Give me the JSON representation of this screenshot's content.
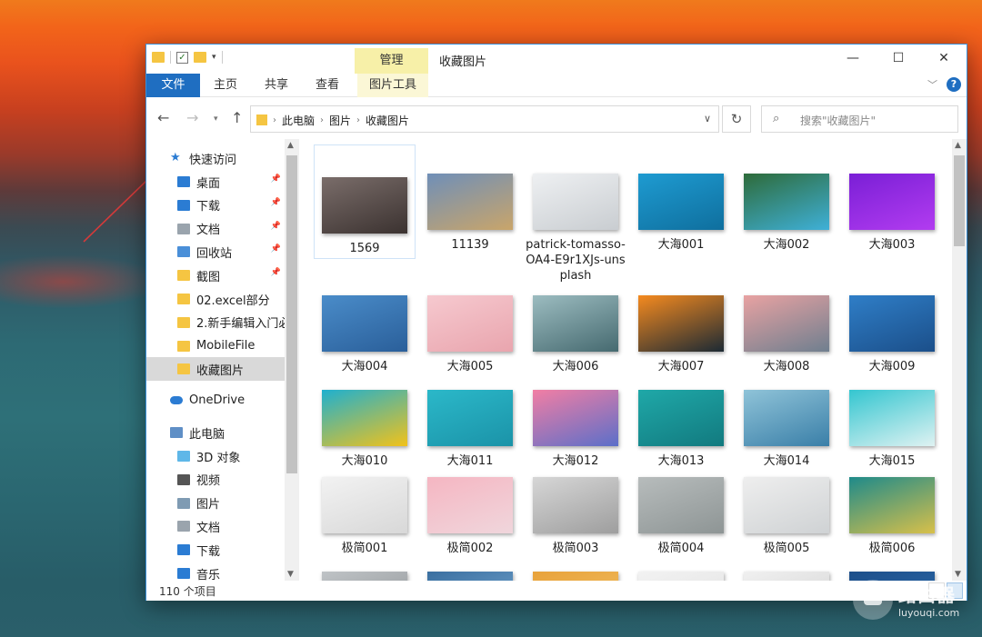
{
  "window": {
    "title": "收藏图片",
    "contextual_tab": "管理",
    "controls": {
      "minimize": "—",
      "maximize": "☐",
      "close": "✕"
    }
  },
  "ribbon": {
    "tabs": [
      "文件",
      "主页",
      "共享",
      "查看",
      "图片工具"
    ],
    "help": "?"
  },
  "address": {
    "crumbs": [
      "此电脑",
      "图片",
      "收藏图片"
    ],
    "search_placeholder": "搜索\"收藏图片\""
  },
  "sidebar": {
    "quick_access": "快速访问",
    "items": [
      {
        "label": "桌面",
        "icon": "desktop-icon",
        "color": "#2b7cd3",
        "pinned": true
      },
      {
        "label": "下载",
        "icon": "download-icon",
        "color": "#2b7cd3",
        "pinned": true
      },
      {
        "label": "文档",
        "icon": "document-icon",
        "color": "#9aa4ad",
        "pinned": true
      },
      {
        "label": "回收站",
        "icon": "recycle-bin-icon",
        "color": "#4a8fd8",
        "pinned": true
      },
      {
        "label": "截图",
        "icon": "folder-icon",
        "color": "#f5c542",
        "pinned": true
      },
      {
        "label": "02.excel部分",
        "icon": "folder-icon",
        "color": "#f5c542",
        "pinned": false
      },
      {
        "label": "2.新手编辑入门必",
        "icon": "folder-icon",
        "color": "#f5c542",
        "pinned": false
      },
      {
        "label": "MobileFile",
        "icon": "folder-icon",
        "color": "#f5c542",
        "pinned": false
      },
      {
        "label": "收藏图片",
        "icon": "folder-icon",
        "color": "#f5c542",
        "pinned": false,
        "selected": true
      }
    ],
    "onedrive": "OneDrive",
    "this_pc": "此电脑",
    "pc_items": [
      {
        "label": "3D 对象",
        "icon": "3d-objects-icon",
        "color": "#5fb7e8"
      },
      {
        "label": "视频",
        "icon": "video-icon",
        "color": "#555"
      },
      {
        "label": "图片",
        "icon": "picture-icon",
        "color": "#7f9bb3"
      },
      {
        "label": "文档",
        "icon": "document-icon",
        "color": "#9aa4ad"
      },
      {
        "label": "下载",
        "icon": "download-icon",
        "color": "#2b7cd3"
      },
      {
        "label": "音乐",
        "icon": "music-icon",
        "color": "#2b7cd3"
      }
    ]
  },
  "files": [
    {
      "name": "1569",
      "c1": "#7a6d6a",
      "c2": "#3b3230"
    },
    {
      "name": "11139",
      "c1": "#6f8fb8",
      "c2": "#c9a56a"
    },
    {
      "name": "patrick-tomasso-OA4-E9r1XJs-unsplash",
      "c1": "#eef0f2",
      "c2": "#c9cdd1"
    },
    {
      "name": "大海001",
      "c1": "#1e9bd1",
      "c2": "#0f6f9e"
    },
    {
      "name": "大海002",
      "c1": "#2e6b3a",
      "c2": "#3fb0d8"
    },
    {
      "name": "大海003",
      "c1": "#7a1fd6",
      "c2": "#b23cf0"
    },
    {
      "name": "大海004",
      "c1": "#4a8cc9",
      "c2": "#2a5f9a"
    },
    {
      "name": "大海005",
      "c1": "#f6c9cf",
      "c2": "#e9a5ae"
    },
    {
      "name": "大海006",
      "c1": "#9cbcc0",
      "c2": "#466a70"
    },
    {
      "name": "大海007",
      "c1": "#f58a1f",
      "c2": "#1c2a34"
    },
    {
      "name": "大海008",
      "c1": "#e8a2a2",
      "c2": "#6f7f8f"
    },
    {
      "name": "大海009",
      "c1": "#2f7ec7",
      "c2": "#1b4f8a"
    },
    {
      "name": "大海010",
      "c1": "#1fb0cf",
      "c2": "#f2c21a"
    },
    {
      "name": "大海011",
      "c1": "#2bb8c9",
      "c2": "#1b93a8"
    },
    {
      "name": "大海012",
      "c1": "#f27ea4",
      "c2": "#5b6fc9"
    },
    {
      "name": "大海013",
      "c1": "#1fa8a8",
      "c2": "#127a7f"
    },
    {
      "name": "大海014",
      "c1": "#8fc3d8",
      "c2": "#3a7fa8"
    },
    {
      "name": "大海015",
      "c1": "#34c6d0",
      "c2": "#dff2f2"
    },
    {
      "name": "极简001",
      "c1": "#f2f2f2",
      "c2": "#d8d8d8"
    },
    {
      "name": "极简002",
      "c1": "#f5b6c2",
      "c2": "#f0d6dc"
    },
    {
      "name": "极简003",
      "c1": "#d6d6d6",
      "c2": "#9e9e9e"
    },
    {
      "name": "极简004",
      "c1": "#b7bcbc",
      "c2": "#8e9595"
    },
    {
      "name": "极简005",
      "c1": "#eeeeee",
      "c2": "#cfd2d4"
    },
    {
      "name": "极简006",
      "c1": "#1e8a8a",
      "c2": "#d8c04a"
    },
    {
      "name": "",
      "c1": "#bfc3c6",
      "c2": "#8a8e91"
    },
    {
      "name": "",
      "c1": "#3a6fa0",
      "c2": "#7fb0d8"
    },
    {
      "name": "",
      "c1": "#e8a23a",
      "c2": "#f2c46a"
    },
    {
      "name": "",
      "c1": "#f2f2f2",
      "c2": "#e0e0e0"
    },
    {
      "name": "",
      "c1": "#f0f0f0",
      "c2": "#d0d0d0"
    },
    {
      "name": "",
      "c1": "#1d4f8a",
      "c2": "#2f6fb0"
    }
  ],
  "status": {
    "count": "110 个项目"
  },
  "watermark": {
    "cn": "路由器",
    "en": "luyouqi.com"
  }
}
